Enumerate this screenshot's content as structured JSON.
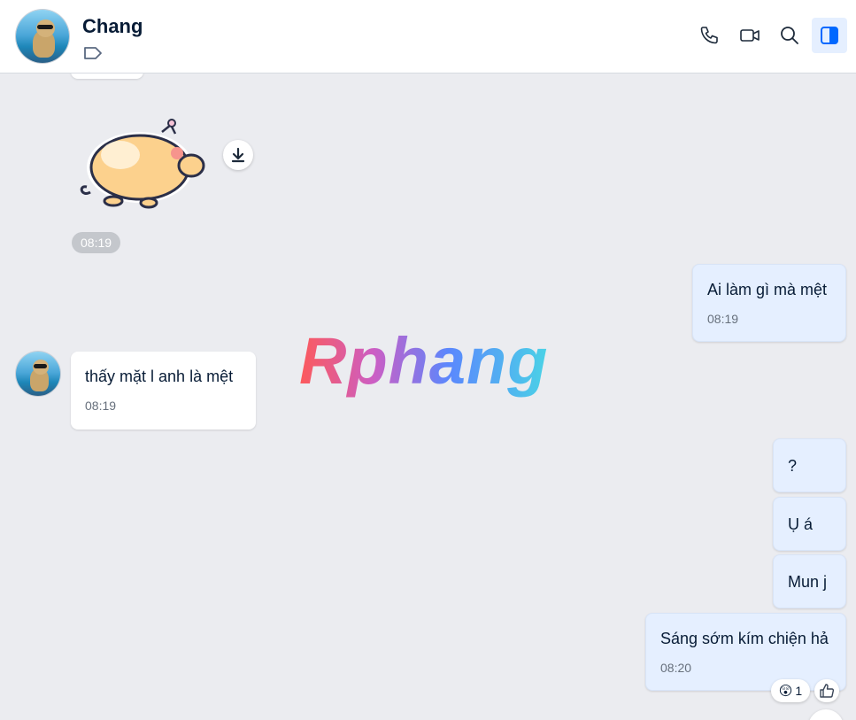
{
  "header": {
    "contact_name": "Chang"
  },
  "messages": {
    "top_time": "08:19",
    "out1": {
      "text": "Ai làm gì mà mệt",
      "time": "08:19"
    },
    "in1": {
      "text": "thấy mặt l anh là mệt",
      "time": "08:19"
    },
    "out2": {
      "text": "?"
    },
    "out3": {
      "text": "Ụ á"
    },
    "out4": {
      "text": "Mun j"
    },
    "out5": {
      "text": "Sáng sớm kím chiện hả",
      "time": "08:20"
    }
  },
  "reaction": {
    "emoji": "😲",
    "count": "1"
  },
  "watermark": {
    "text": "Rphang"
  },
  "colors": {
    "accent": "#0068ff",
    "out_bubble": "#e5efff",
    "in_bubble": "#ffffff",
    "background": "#ebecf0"
  }
}
